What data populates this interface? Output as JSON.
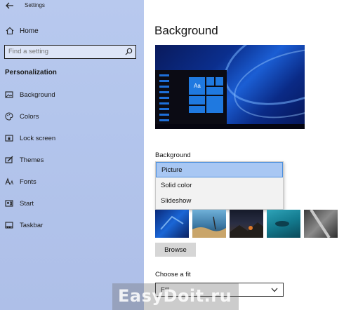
{
  "window": {
    "title": "Settings"
  },
  "nav": {
    "home_label": "Home",
    "search_placeholder": "Find a setting",
    "section_title": "Personalization",
    "items": [
      {
        "label": "Background",
        "icon": "image-icon"
      },
      {
        "label": "Colors",
        "icon": "palette-icon"
      },
      {
        "label": "Lock screen",
        "icon": "lock-screen-icon"
      },
      {
        "label": "Themes",
        "icon": "brush-icon"
      },
      {
        "label": "Fonts",
        "icon": "font-icon"
      },
      {
        "label": "Start",
        "icon": "start-icon"
      },
      {
        "label": "Taskbar",
        "icon": "taskbar-icon"
      }
    ]
  },
  "main": {
    "page_title": "Background",
    "preview": {
      "tile_label": "Aa"
    },
    "background_label": "Background",
    "background_options": [
      "Picture",
      "Solid color",
      "Slideshow"
    ],
    "background_selected": "Picture",
    "browse_label": "Browse",
    "fit_label": "Choose a fit",
    "fit_value": "Fill"
  },
  "colors": {
    "accent": "#1f79e0",
    "sidebar": "#b3c5ec",
    "selected_option": "#a8c7f3"
  },
  "watermark": {
    "text": "EasyDoit.ru"
  }
}
